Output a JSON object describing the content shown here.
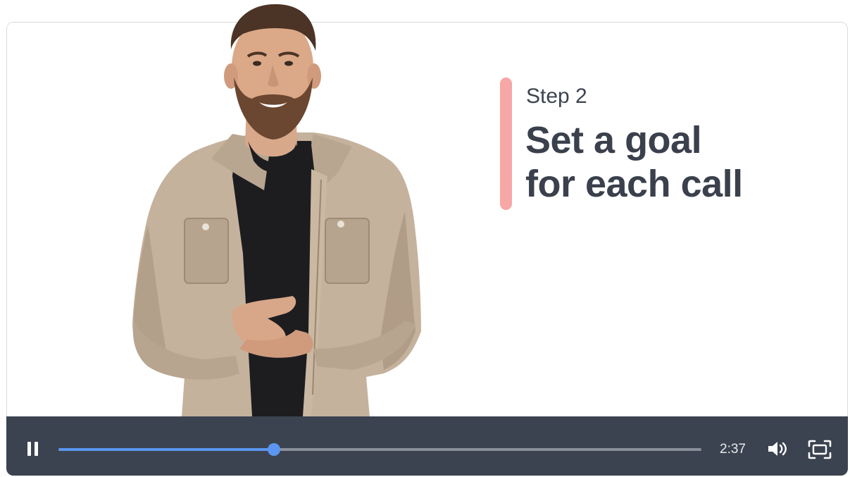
{
  "slide": {
    "step_label": "Step 2",
    "title_line1": "Set a goal",
    "title_line2": "for each call",
    "accent_color": "#f7a7a5"
  },
  "player": {
    "state": "playing",
    "time_display": "2:37",
    "progress_fraction": 0.335,
    "accent_color": "#5b96f0",
    "controls_background": "#3b4350"
  },
  "icons": {
    "play_pause": "pause-icon",
    "volume": "volume-icon",
    "fullscreen": "fullscreen-icon"
  }
}
